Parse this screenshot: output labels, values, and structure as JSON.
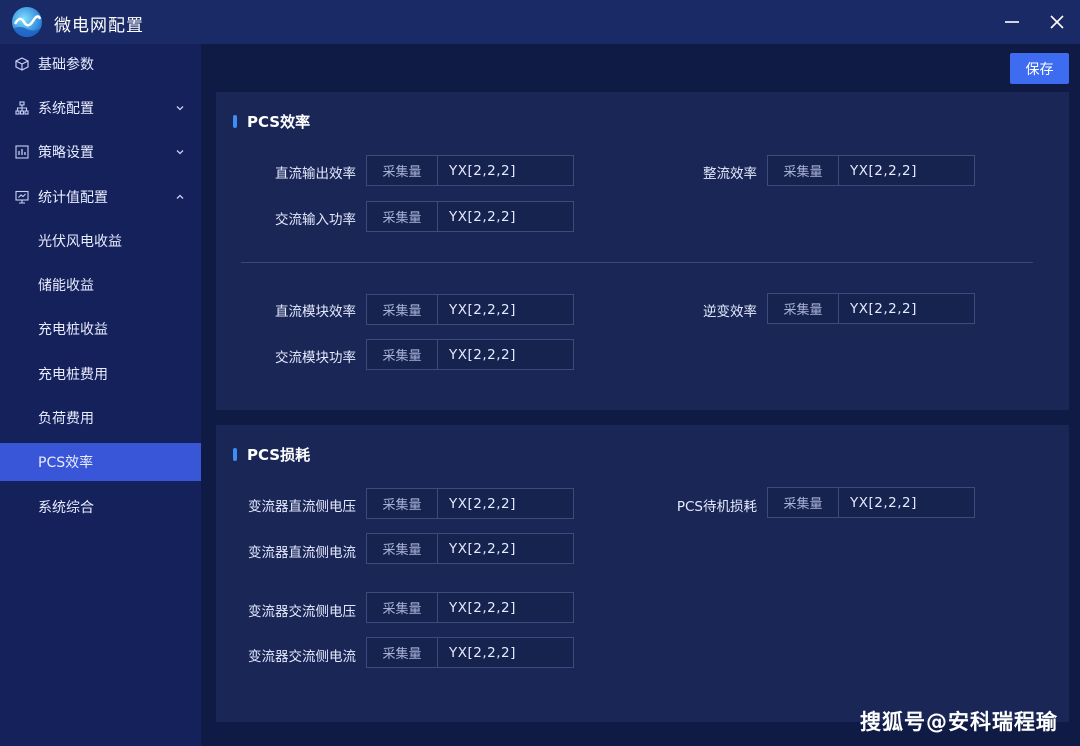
{
  "app": {
    "title": "微电网配置"
  },
  "toolbar": {
    "save_label": "保存"
  },
  "sidebar": {
    "items": [
      {
        "label": "基础参数"
      },
      {
        "label": "系统配置"
      },
      {
        "label": "策略设置"
      },
      {
        "label": "统计值配置"
      },
      {
        "label": "光伏风电收益"
      },
      {
        "label": "储能收益"
      },
      {
        "label": "充电桩收益"
      },
      {
        "label": "充电桩费用"
      },
      {
        "label": "负荷费用"
      },
      {
        "label": "PCS效率"
      },
      {
        "label": "系统综合"
      }
    ]
  },
  "panels": {
    "efficiency": {
      "title": "PCS效率",
      "fields": [
        {
          "label": "直流输出效率",
          "tag": "采集量",
          "value": "YX[2,2,2]"
        },
        {
          "label": "整流效率",
          "tag": "采集量",
          "value": "YX[2,2,2]"
        },
        {
          "label": "交流输入功率",
          "tag": "采集量",
          "value": "YX[2,2,2]"
        },
        {
          "label": "直流模块效率",
          "tag": "采集量",
          "value": "YX[2,2,2]"
        },
        {
          "label": "逆变效率",
          "tag": "采集量",
          "value": "YX[2,2,2]"
        },
        {
          "label": "交流模块功率",
          "tag": "采集量",
          "value": "YX[2,2,2]"
        }
      ]
    },
    "loss": {
      "title": "PCS损耗",
      "fields": [
        {
          "label": "变流器直流侧电压",
          "tag": "采集量",
          "value": "YX[2,2,2]"
        },
        {
          "label": "PCS待机损耗",
          "tag": "采集量",
          "value": "YX[2,2,2]"
        },
        {
          "label": "变流器直流侧电流",
          "tag": "采集量",
          "value": "YX[2,2,2]"
        },
        {
          "label": "变流器交流侧电压",
          "tag": "采集量",
          "value": "YX[2,2,2]"
        },
        {
          "label": "变流器交流侧电流",
          "tag": "采集量",
          "value": "YX[2,2,2]"
        }
      ]
    }
  },
  "watermark": "搜狐号@安科瑞程瑜",
  "colors": {
    "accent": "#3e6cf0",
    "active_nav": "#3a56d8",
    "background": "#0f1a45"
  }
}
